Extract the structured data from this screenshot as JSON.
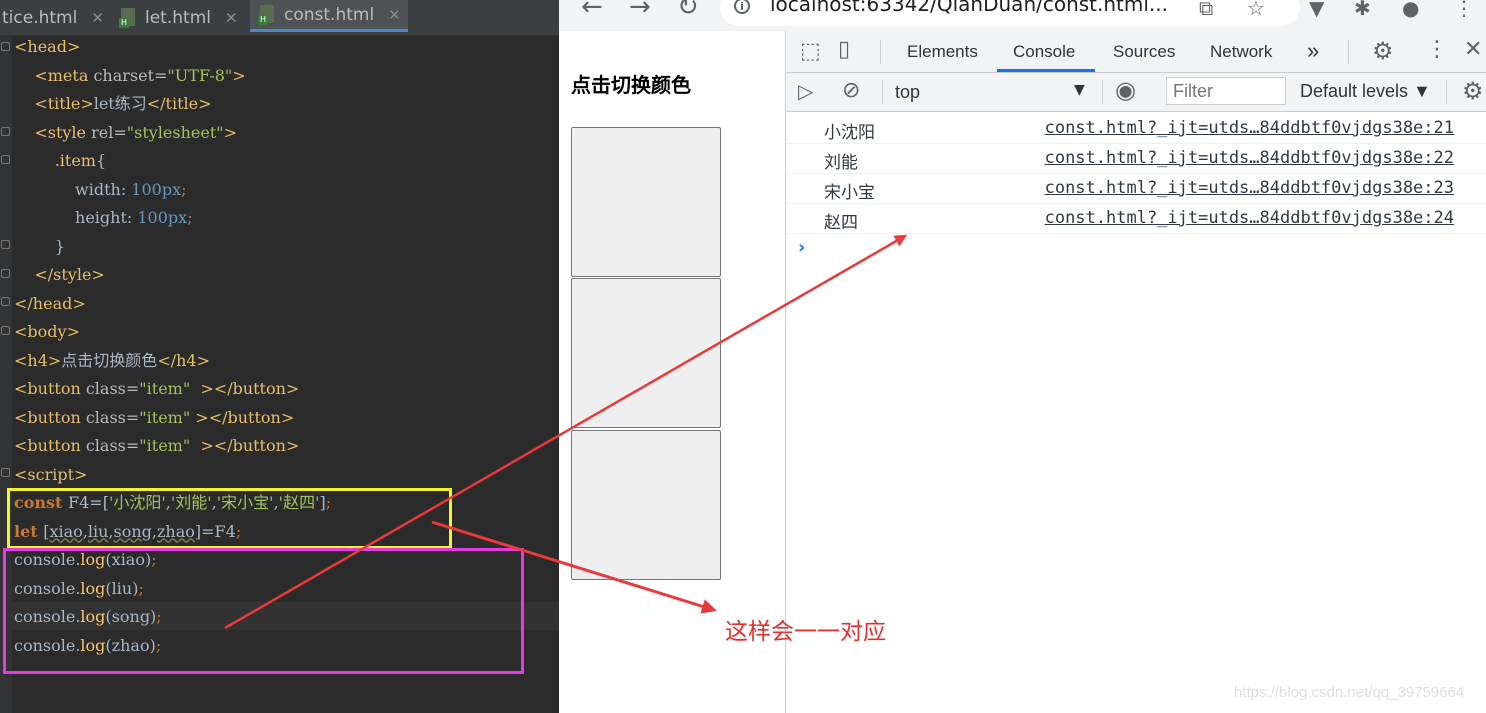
{
  "ide": {
    "tabs": [
      {
        "label": "tice.html",
        "active": false
      },
      {
        "label": "let.html",
        "active": false
      },
      {
        "label": "const.html",
        "active": true
      }
    ],
    "lines": [
      {
        "parts": [
          [
            "tag",
            "<head>"
          ]
        ]
      },
      {
        "parts": [
          [
            "txt",
            "    "
          ],
          [
            "tag",
            "<meta "
          ],
          [
            "attr",
            "charset="
          ],
          [
            "str",
            "\"UTF-8\""
          ],
          [
            "tag",
            ">"
          ]
        ]
      },
      {
        "parts": [
          [
            "txt",
            "    "
          ],
          [
            "tag",
            "<title>"
          ],
          [
            "txt",
            "let练习"
          ],
          [
            "tag",
            "</title>"
          ]
        ]
      },
      {
        "parts": [
          [
            "txt",
            "    "
          ],
          [
            "tag",
            "<style "
          ],
          [
            "attr",
            "rel="
          ],
          [
            "str",
            "\"stylesheet\""
          ],
          [
            "tag",
            ">"
          ]
        ]
      },
      {
        "parts": [
          [
            "txt",
            "        "
          ],
          [
            "sel",
            ".item"
          ],
          [
            "txt",
            "{"
          ]
        ]
      },
      {
        "parts": [
          [
            "txt",
            "            width: "
          ],
          [
            "num",
            "100px"
          ],
          [
            "pn",
            ";"
          ]
        ]
      },
      {
        "parts": [
          [
            "txt",
            "            height: "
          ],
          [
            "num",
            "100px"
          ],
          [
            "pn",
            ";"
          ]
        ]
      },
      {
        "parts": [
          [
            "txt",
            "        }"
          ]
        ]
      },
      {
        "parts": [
          [
            "txt",
            "    "
          ],
          [
            "tag",
            "</style>"
          ]
        ]
      },
      {
        "parts": [
          [
            "tag",
            "</head>"
          ]
        ]
      },
      {
        "parts": [
          [
            "tag",
            "<body>"
          ]
        ]
      },
      {
        "parts": [
          [
            "tag",
            "<h4>"
          ],
          [
            "txt",
            "点击切换颜色"
          ],
          [
            "tag",
            "</h4>"
          ]
        ]
      },
      {
        "parts": [
          [
            "tag",
            "<button "
          ],
          [
            "attr",
            "class="
          ],
          [
            "str",
            "\"item\""
          ],
          [
            "tag",
            "  ></button>"
          ]
        ]
      },
      {
        "parts": [
          [
            "tag",
            "<button "
          ],
          [
            "attr",
            "class="
          ],
          [
            "str",
            "\"item\""
          ],
          [
            "tag",
            " ></button>"
          ]
        ]
      },
      {
        "parts": [
          [
            "tag",
            "<button "
          ],
          [
            "attr",
            "class="
          ],
          [
            "str",
            "\"item\""
          ],
          [
            "tag",
            "  ></button>"
          ]
        ]
      },
      {
        "parts": [
          [
            "tag",
            "<script>"
          ]
        ]
      },
      {
        "parts": [
          [
            "kw",
            "const "
          ],
          [
            "txt",
            "F4=["
          ],
          [
            "str",
            "'小沈阳'"
          ],
          [
            "txt",
            ","
          ],
          [
            "str",
            "'刘能'"
          ],
          [
            "txt",
            ","
          ],
          [
            "str",
            "'宋小宝'"
          ],
          [
            "txt",
            ","
          ],
          [
            "str",
            "'赵四'"
          ],
          [
            "txt",
            "]"
          ],
          [
            "pn",
            ";"
          ]
        ]
      },
      {
        "parts": [
          [
            "kw",
            "let "
          ],
          [
            "txt",
            "["
          ],
          [
            "ul",
            "xiao"
          ],
          [
            "txt",
            ","
          ],
          [
            "ul",
            "liu"
          ],
          [
            "txt",
            ","
          ],
          [
            "ul",
            "song"
          ],
          [
            "txt",
            ","
          ],
          [
            "ul",
            "zhao"
          ],
          [
            "txt",
            "]=F4"
          ],
          [
            "pn",
            ";"
          ]
        ]
      },
      {
        "parts": [
          [
            "txt",
            "console."
          ],
          [
            "fn",
            "log"
          ],
          [
            "txt",
            "(xiao)"
          ],
          [
            "pn",
            ";"
          ]
        ]
      },
      {
        "parts": [
          [
            "txt",
            "console."
          ],
          [
            "fn",
            "log"
          ],
          [
            "txt",
            "(liu)"
          ],
          [
            "pn",
            ";"
          ]
        ]
      },
      {
        "parts": [
          [
            "txt",
            "console."
          ],
          [
            "fn",
            "log"
          ],
          [
            "txt",
            "(song)"
          ],
          [
            "pn",
            ";"
          ]
        ]
      },
      {
        "parts": [
          [
            "txt",
            "console."
          ],
          [
            "fn",
            "log"
          ],
          [
            "txt",
            "(zhao)"
          ],
          [
            "pn",
            ";"
          ]
        ]
      }
    ]
  },
  "browser": {
    "url": "localhost:63342/QianDuan/const.html...",
    "page": {
      "heading": "点击切换颜色",
      "button_count": 3
    },
    "devtools": {
      "tabs": [
        "Elements",
        "Console",
        "Sources",
        "Network"
      ],
      "active_tab": "Console",
      "more_tabs": "»",
      "context": "top",
      "filter_placeholder": "Filter",
      "levels": "Default levels ▼",
      "logs": [
        {
          "message": "小沈阳",
          "source": "const.html?_ijt=utds…84ddbtf0vjdgs38e:21"
        },
        {
          "message": "刘能",
          "source": "const.html?_ijt=utds…84ddbtf0vjdgs38e:22"
        },
        {
          "message": "宋小宝",
          "source": "const.html?_ijt=utds…84ddbtf0vjdgs38e:23"
        },
        {
          "message": "赵四",
          "source": "const.html?_ijt=utds…84ddbtf0vjdgs38e:24"
        }
      ],
      "prompt": "›"
    }
  },
  "annotation": {
    "text": "这样会一一对应",
    "color": "#e03131"
  },
  "watermark": "https://blog.csdn.net/qq_39759664"
}
